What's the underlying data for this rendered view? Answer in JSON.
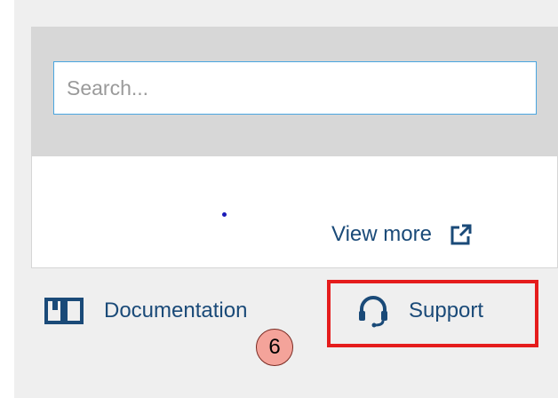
{
  "search": {
    "placeholder": "Search..."
  },
  "view_more": {
    "label": "View more",
    "icon": "external-link-icon"
  },
  "footer": {
    "documentation": {
      "label": "Documentation",
      "icon": "book-icon"
    },
    "support": {
      "label": "Support",
      "icon": "headset-icon"
    }
  },
  "annotation": {
    "step_number": "6",
    "highlight_color": "#e51c1c",
    "badge_color": "#f4a39a"
  },
  "colors": {
    "link": "#1a4a78",
    "accent": "#4aa6e0",
    "panel": "#efefef"
  }
}
